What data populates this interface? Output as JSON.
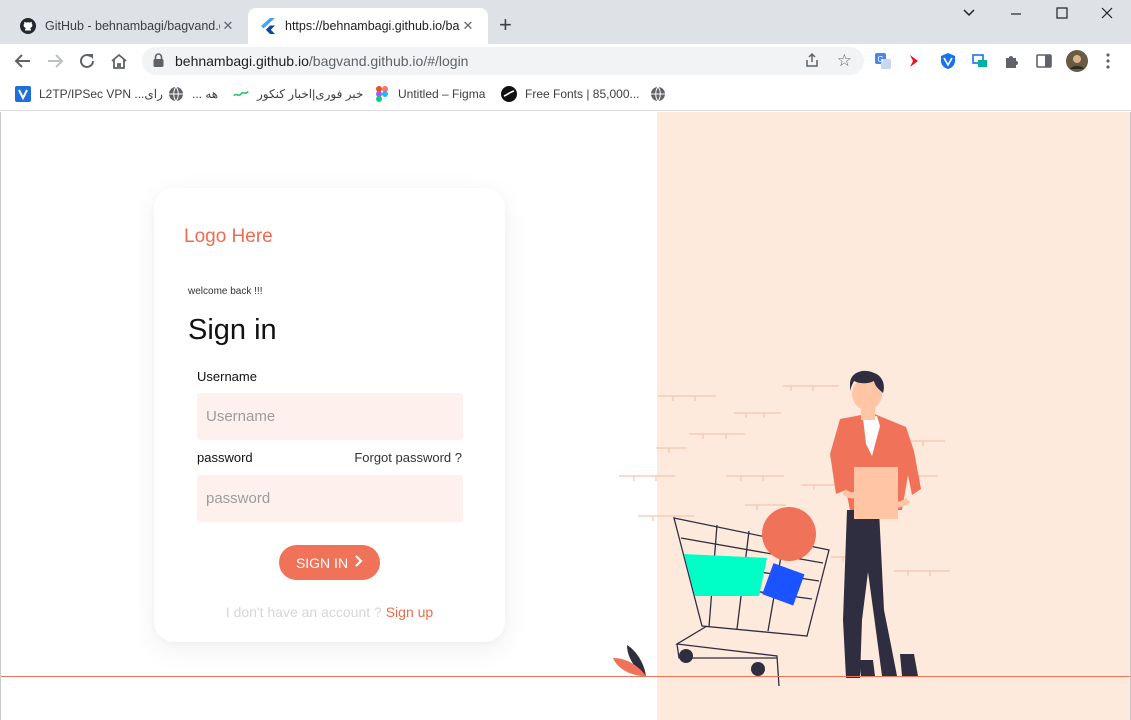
{
  "browser": {
    "tabs": [
      {
        "title": "GitHub - behnambagi/bagvand.g",
        "icon": "github-icon",
        "active": false
      },
      {
        "title": "https://behnambagi.github.io/ba",
        "icon": "flutter-icon",
        "active": true
      }
    ],
    "new_tab_label": "+",
    "url": {
      "domain": "behnambagi.github.io",
      "path": "/bagvand.github.io/#/login"
    },
    "bookmarks": [
      {
        "label": "L2TP/IPSec VPN ...رای",
        "icon": "vpn-icon"
      },
      {
        "label": "... هه",
        "icon": "globe-icon"
      },
      {
        "label": "خبر فوری|اخبار کنکور",
        "icon": "news-icon"
      },
      {
        "label": "Untitled – Figma",
        "icon": "figma-icon"
      },
      {
        "label": "Free Fonts | 85,000...",
        "icon": "fonts-icon"
      },
      {
        "label": "",
        "icon": "globe-icon"
      }
    ]
  },
  "login": {
    "logo": "Logo Here",
    "welcome": "welcome back !!!",
    "heading": "Sign in",
    "username_label": "Username",
    "username_placeholder": "Username",
    "password_label": "password",
    "forgot": "Forgot password ?",
    "password_placeholder": "password",
    "button": "SIGN IN",
    "no_account": "I don't have an account ?",
    "signup": "Sign up"
  },
  "colors": {
    "accent": "#f07258",
    "field_bg": "#fef1ed",
    "illustration_bg": "#feeadc",
    "basket": "#00ffc6",
    "box": "#1a53ff"
  }
}
